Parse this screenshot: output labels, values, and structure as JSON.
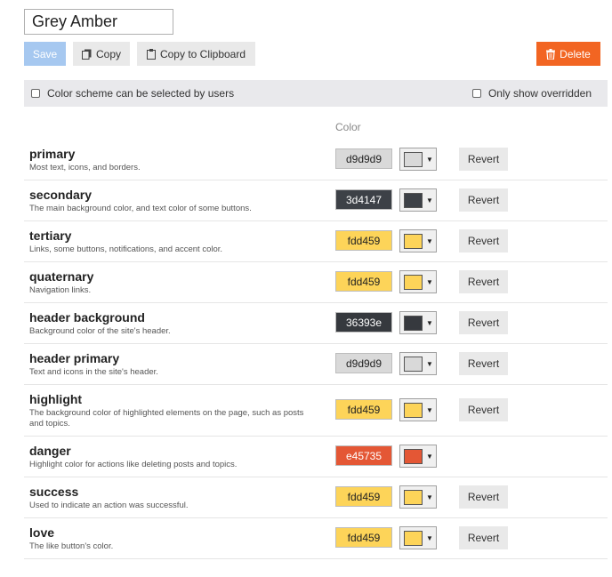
{
  "scheme": {
    "name": "Grey Amber"
  },
  "toolbar": {
    "save_label": "Save",
    "copy_label": "Copy",
    "clipboard_label": "Copy to Clipboard",
    "delete_label": "Delete",
    "save_color": "#a6c8f0",
    "delete_color": "#f26522"
  },
  "options": {
    "selectable_label": "Color scheme can be selected by users",
    "selectable_checked": false,
    "overridden_label": "Only show overridden",
    "overridden_checked": false
  },
  "table": {
    "color_header": "Color"
  },
  "colors": [
    {
      "name": "primary",
      "desc": "Most text, icons, and borders.",
      "hex": "d9d9d9",
      "revert": "Revert"
    },
    {
      "name": "secondary",
      "desc": "The main background color, and text color of some buttons.",
      "hex": "3d4147",
      "revert": "Revert"
    },
    {
      "name": "tertiary",
      "desc": "Links, some buttons, notifications, and accent color.",
      "hex": "fdd459",
      "revert": "Revert"
    },
    {
      "name": "quaternary",
      "desc": "Navigation links.",
      "hex": "fdd459",
      "revert": "Revert"
    },
    {
      "name": "header background",
      "desc": "Background color of the site's header.",
      "hex": "36393e",
      "revert": "Revert"
    },
    {
      "name": "header primary",
      "desc": "Text and icons in the site's header.",
      "hex": "d9d9d9",
      "revert": "Revert"
    },
    {
      "name": "highlight",
      "desc": "The background color of highlighted elements on the page, such as posts and topics.",
      "hex": "fdd459",
      "revert": "Revert"
    },
    {
      "name": "danger",
      "desc": "Highlight color for actions like deleting posts and topics.",
      "hex": "e45735",
      "revert": ""
    },
    {
      "name": "success",
      "desc": "Used to indicate an action was successful.",
      "hex": "fdd459",
      "revert": "Revert"
    },
    {
      "name": "love",
      "desc": "The like button's color.",
      "hex": "fdd459",
      "revert": "Revert"
    }
  ],
  "icons": {
    "copy": "copy-icon",
    "clipboard": "clipboard-icon",
    "delete": "trash-icon",
    "dropdown": "caret-down-icon"
  }
}
